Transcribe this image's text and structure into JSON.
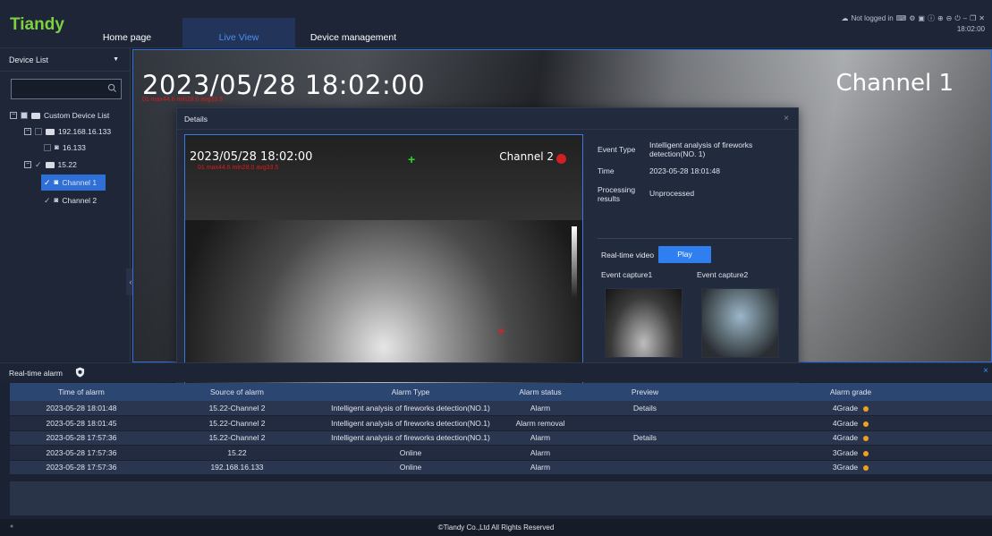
{
  "app": {
    "logo": "Tiandy",
    "nav": {
      "home": "Home page",
      "live": "Live View",
      "device": "Device management"
    },
    "status": {
      "login": "Not logged in",
      "time": "18:02:00"
    }
  },
  "sidebar": {
    "title": "Device List",
    "tree": {
      "root": "Custom Device List",
      "group1": "192.168.16.133",
      "group1_child": "16.133",
      "group2": "15.22",
      "channel1": "Channel 1",
      "channel2": "Channel 2"
    }
  },
  "video": {
    "timestamp": "2023/05/28 18:02:00",
    "stats": "01 max44.6 min28.0 avg33.5",
    "channel": "Channel 1"
  },
  "details": {
    "title": "Details",
    "close": "×",
    "thermal": {
      "timestamp": "2023/05/28 18:02:00",
      "stats": "01 max44.6 min28.0 avg33.5",
      "channel": "Channel 2"
    },
    "event_type_label": "Event Type",
    "event_type_value": "Intelligent analysis of fireworks detection(NO. 1)",
    "time_label": "Time",
    "time_value": "2023-05-28 18:01:48",
    "processing_label": "Processing results",
    "processing_value": "Unprocessed",
    "realtime_label": "Real-time video",
    "play": "Play",
    "capture1": "Event capture1",
    "capture2": "Event capture2"
  },
  "alarm": {
    "title": "Real-time alarm",
    "close": "×",
    "columns": [
      "Time of alarm",
      "Source of alarm",
      "Alarm Type",
      "Alarm status",
      "Preview",
      "Alarm grade"
    ],
    "rows": [
      [
        "2023-05-28 18:01:48",
        "15.22-Channel 2",
        "Intelligent analysis of fireworks detection(NO.1)",
        "Alarm",
        "Details",
        "4Grade"
      ],
      [
        "2023-05-28 18:01:45",
        "15.22-Channel 2",
        "Intelligent analysis of fireworks detection(NO.1)",
        "Alarm removal",
        "",
        "4Grade"
      ],
      [
        "2023-05-28 17:57:36",
        "15.22-Channel 2",
        "Intelligent analysis of fireworks detection(NO.1)",
        "Alarm",
        "Details",
        "4Grade"
      ],
      [
        "2023-05-28 17:57:36",
        "15.22",
        "Online",
        "Alarm",
        "",
        "3Grade"
      ],
      [
        "2023-05-28 17:57:36",
        "192.168.16.133",
        "Online",
        "Alarm",
        "",
        "3Grade"
      ]
    ]
  },
  "footer": {
    "copyright": "©Tiandy Co.,Ltd All Rights Reserved"
  },
  "colors": {
    "accent": "#2f7ff0",
    "brand": "#7ed03f",
    "alarm_red": "#e01818",
    "grade_dot": "#f0a020"
  }
}
